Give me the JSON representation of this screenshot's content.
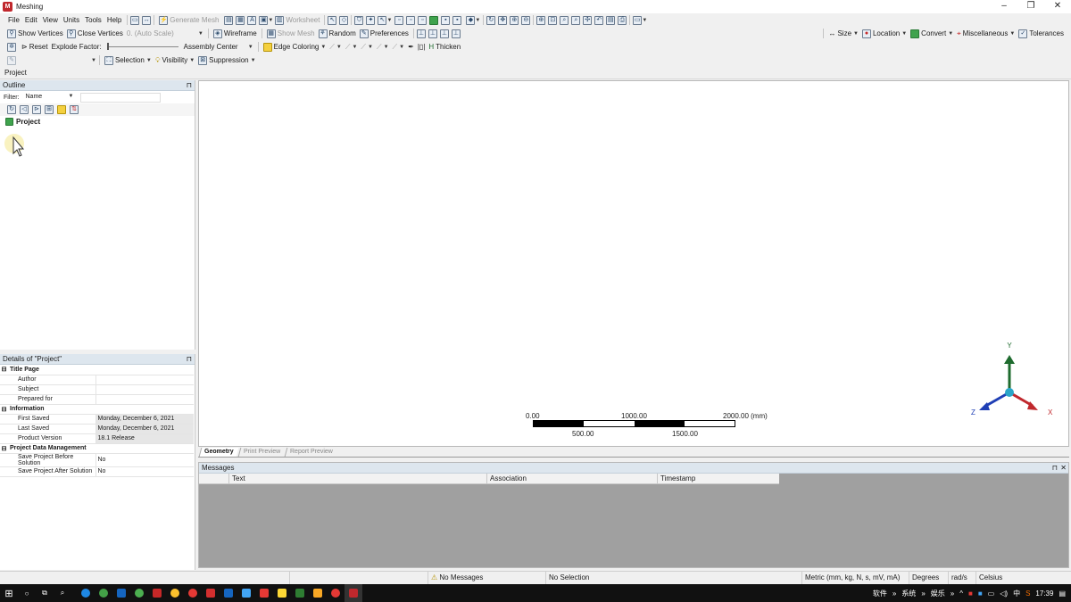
{
  "window": {
    "title": "Meshing"
  },
  "menu": [
    "File",
    "Edit",
    "View",
    "Units",
    "Tools",
    "Help"
  ],
  "toolbar1": {
    "generate_mesh": "Generate Mesh",
    "worksheet": "Worksheet"
  },
  "toolbar2": {
    "show_vertices": "Show Vertices",
    "close_vertices": "Close Vertices",
    "auto_scale": "0. (Auto Scale)",
    "wireframe": "Wireframe",
    "show_mesh": "Show Mesh",
    "random": "Random",
    "preferences": "Preferences",
    "size": "Size",
    "location": "Location",
    "convert": "Convert",
    "miscellaneous": "Miscellaneous",
    "tolerances": "Tolerances"
  },
  "toolbar3": {
    "reset": "Reset",
    "explode_factor": "Explode Factor:",
    "assembly_center": "Assembly Center",
    "edge_coloring": "Edge Coloring",
    "thicken": "Thicken"
  },
  "toolbar4": {
    "selection": "Selection",
    "visibility": "Visibility",
    "suppression": "Suppression"
  },
  "breadcrumb": "Project",
  "outline": {
    "title": "Outline",
    "filter_label": "Filter:",
    "filter_value": "Name",
    "tree_root": "Project"
  },
  "details": {
    "title": "Details of \"Project\"",
    "sections": [
      {
        "name": "Title Page",
        "rows": [
          {
            "key": "Author",
            "value": ""
          },
          {
            "key": "Subject",
            "value": ""
          },
          {
            "key": "Prepared for",
            "value": ""
          }
        ]
      },
      {
        "name": "Information",
        "rows": [
          {
            "key": "First Saved",
            "value": "Monday, December 6, 2021"
          },
          {
            "key": "Last Saved",
            "value": "Monday, December 6, 2021"
          },
          {
            "key": "Product Version",
            "value": "18.1  Release"
          }
        ]
      },
      {
        "name": "Project Data Management",
        "rows": [
          {
            "key": "Save Project Before Solution",
            "value": "No"
          },
          {
            "key": "Save Project After Solution",
            "value": "No"
          }
        ]
      }
    ]
  },
  "scale_bar": {
    "top_labels": [
      "0.00",
      "1000.00",
      "2000.00 (mm)"
    ],
    "bottom_labels": [
      "500.00",
      "1500.00"
    ]
  },
  "triad": {
    "x": "X",
    "y": "Y",
    "z": "Z",
    "colors": {
      "x": "#c0282d",
      "y": "#1e6b2e",
      "z": "#1f3fb5",
      "center": "#2aa6c8"
    }
  },
  "view_tabs": [
    "Geometry",
    "Print Preview",
    "Report Preview"
  ],
  "messages": {
    "title": "Messages",
    "columns": [
      "Text",
      "Association",
      "Timestamp"
    ]
  },
  "status": {
    "messages": "No Messages",
    "selection": "No Selection",
    "units": "Metric (mm, kg, N, s, mV, mA)",
    "angle": "Degrees",
    "rate": "rad/s",
    "temperature": "Celsius"
  },
  "taskbar": {
    "tray_items": [
      "软件",
      "系统",
      "娱乐",
      "中"
    ],
    "clock": "17:39"
  }
}
